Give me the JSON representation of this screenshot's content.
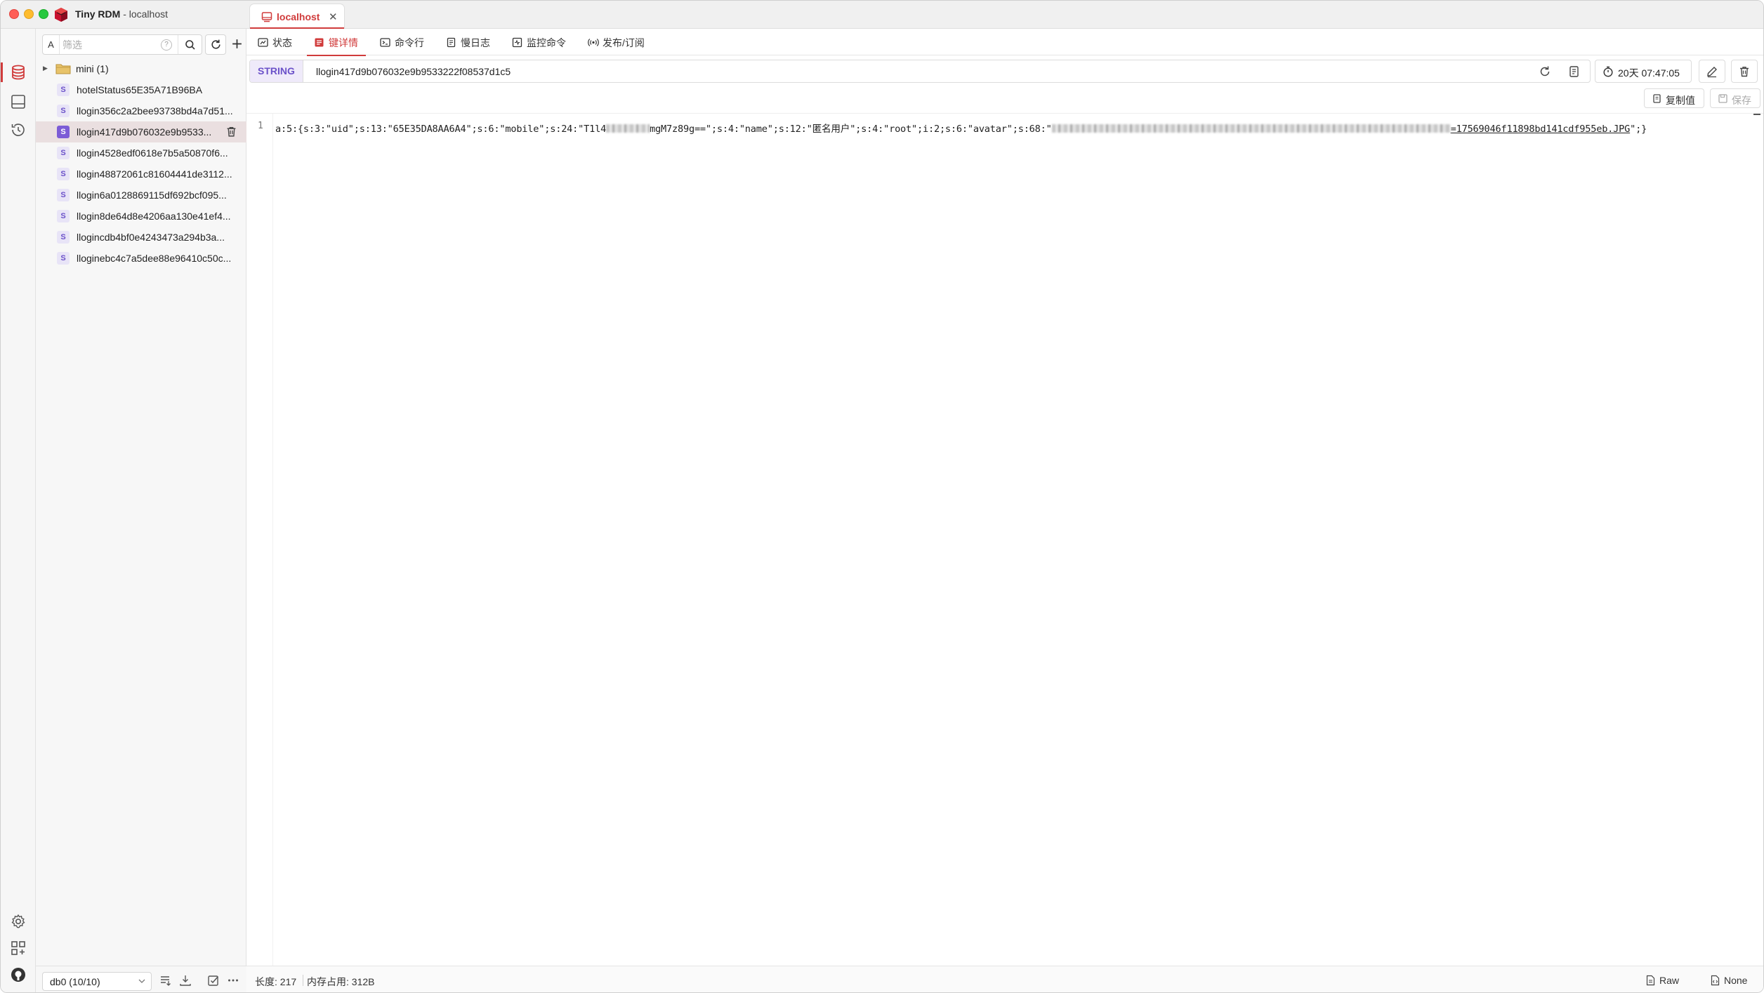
{
  "app": {
    "name": "Tiny RDM",
    "title_suffix": " - localhost",
    "connection_tab": "localhost"
  },
  "sidebar": {
    "filter_prefix": "A",
    "filter_placeholder": "筛选",
    "help_mark": "?",
    "db_group": "mini (1)",
    "keys": [
      {
        "type": "S",
        "name": "hotelStatus65E35A71B96BA"
      },
      {
        "type": "S",
        "name": "llogin356c2a2bee93738bd4a7d51..."
      },
      {
        "type": "S",
        "name": "llogin417d9b076032e9b9533...",
        "selected": true
      },
      {
        "type": "S",
        "name": "llogin4528edf0618e7b5a50870f6..."
      },
      {
        "type": "S",
        "name": "llogin48872061c81604441de3112..."
      },
      {
        "type": "S",
        "name": "llogin6a0128869115df692bcf095..."
      },
      {
        "type": "S",
        "name": "llogin8de64d8e4206aa130e41ef4..."
      },
      {
        "type": "S",
        "name": "llogincdb4bf0e4243473a294b3a..."
      },
      {
        "type": "S",
        "name": "lloginebc4c7a5dee88e96410c50c..."
      }
    ],
    "db_select": "db0 (10/10)"
  },
  "tabs": [
    {
      "label": "状态",
      "icon": "status-icon"
    },
    {
      "label": "键详情",
      "icon": "key-detail-icon",
      "active": true
    },
    {
      "label": "命令行",
      "icon": "terminal-icon"
    },
    {
      "label": "慢日志",
      "icon": "slow-log-icon"
    },
    {
      "label": "监控命令",
      "icon": "monitor-icon"
    },
    {
      "label": "发布/订阅",
      "icon": "pubsub-icon"
    }
  ],
  "key": {
    "type": "STRING",
    "name": "llogin417d9b076032e9b9533222f08537d1c5",
    "ttl": "20天 07:47:05"
  },
  "value_toolbar": {
    "copy": "复制值",
    "save": "保存"
  },
  "editor": {
    "line_number": "1",
    "seg1": "a:5:{s:3:\"uid\";s:13:\"65E35DA8AA6A4\";s:6:\"mobile\";s:24:\"T1l4",
    "seg2": "mgM7z89g==\";s:4:\"name\";s:12:\"匿名用户\";s:4:\"root\";i:2;s:6:\"avatar\";s:68:\"",
    "seg3": "=17569046f11898bd141cdf955eb.JPG",
    "seg4": "\";}"
  },
  "status": {
    "length": "长度: 217",
    "memory": "内存占用: 312B",
    "view_mode": "Raw",
    "decode": "None"
  },
  "colors": {
    "accent": "#d03b3b",
    "string_type": "#6b51c9"
  }
}
